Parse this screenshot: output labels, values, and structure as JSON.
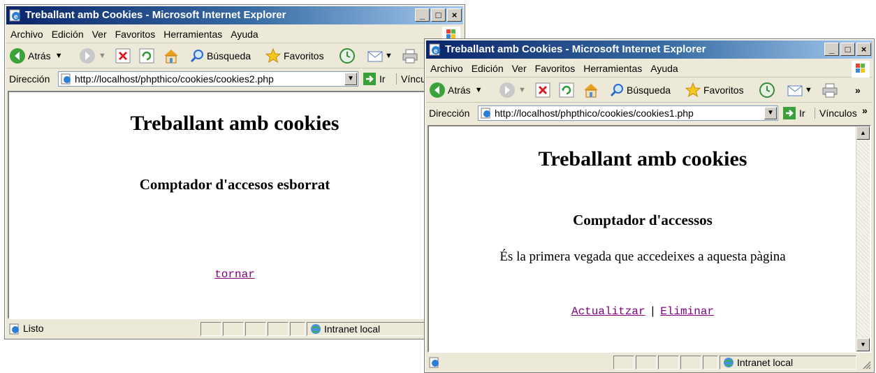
{
  "back_window": {
    "title": "Treballant amb Cookies - Microsoft Internet Explorer",
    "menu": [
      "Archivo",
      "Edición",
      "Ver",
      "Favoritos",
      "Herramientas",
      "Ayuda"
    ],
    "toolbar": {
      "back": "Atrás",
      "search": "Búsqueda",
      "favorites": "Favoritos"
    },
    "address_label": "Dirección",
    "url": "http://localhost/phpthico/cookies/cookies2.php",
    "go": "Ir",
    "links": "Víncu",
    "page": {
      "heading": "Treballant amb cookies",
      "subheading": "Comptador d'accesos esborrat",
      "link": "tornar"
    },
    "status": {
      "text": "Listo",
      "zone": "Intranet local"
    }
  },
  "front_window": {
    "title": "Treballant amb Cookies - Microsoft Internet Explorer",
    "menu": [
      "Archivo",
      "Edición",
      "Ver",
      "Favoritos",
      "Herramientas",
      "Ayuda"
    ],
    "toolbar": {
      "back": "Atrás",
      "search": "Búsqueda",
      "favorites": "Favoritos"
    },
    "address_label": "Dirección",
    "url": "http://localhost/phpthico/cookies/cookies1.php",
    "go": "Ir",
    "links": "Vínculos",
    "page": {
      "heading": "Treballant amb cookies",
      "subheading": "Comptador d'accessos",
      "message": "És la primera vegada que accedeixes a aquesta pàgina",
      "link_update": "Actualitzar",
      "separator": "|",
      "link_delete": "Eliminar"
    },
    "status": {
      "zone": "Intranet local"
    }
  },
  "window_buttons": {
    "minimize": "_",
    "maximize": "□",
    "close": "×"
  },
  "colors": {
    "titlebar": "#0a246a",
    "link_visited": "#800080",
    "chrome": "#ece9d8"
  },
  "icons": [
    "ie-page-icon",
    "back-arrow-icon",
    "forward-arrow-icon",
    "stop-icon",
    "refresh-icon",
    "home-icon",
    "search-icon",
    "favorites-star-icon",
    "history-icon",
    "mail-icon",
    "print-icon",
    "go-arrow-icon",
    "windows-logo-icon",
    "globe-zone-icon"
  ]
}
